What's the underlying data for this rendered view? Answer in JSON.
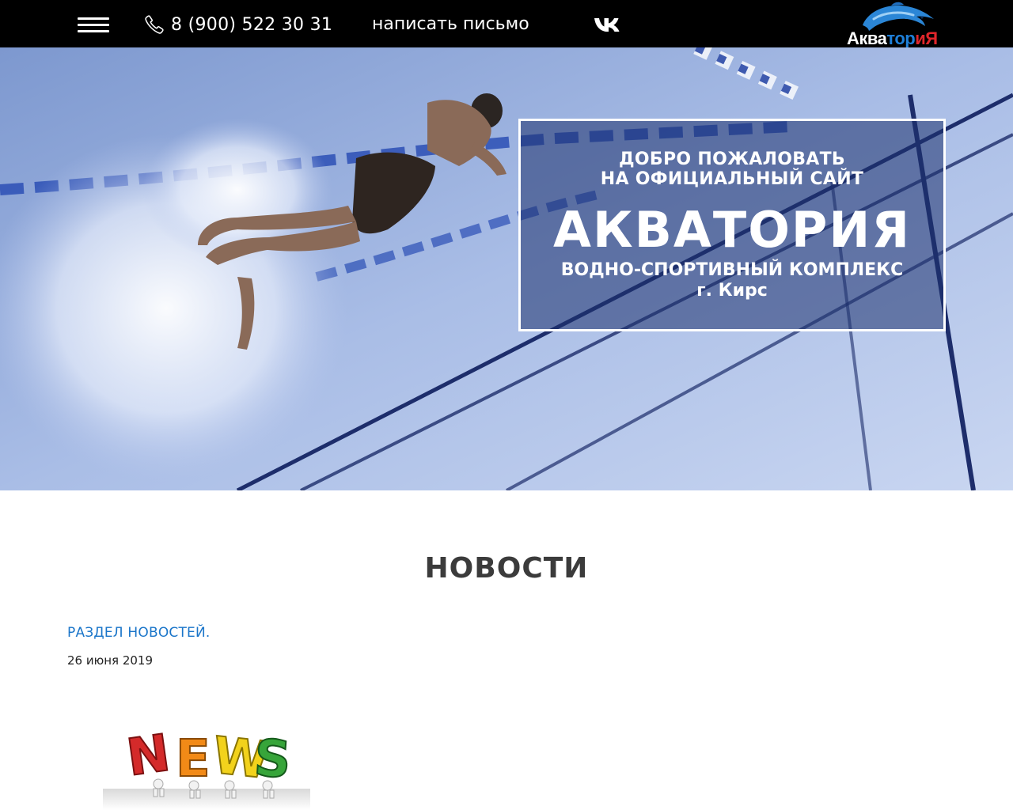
{
  "header": {
    "phone": "8 (900) 522 30 31",
    "mail_link": "написать письмо",
    "vk_icon": "vk-icon",
    "menu_icon": "hamburger-icon",
    "logo": {
      "part1": "Аква",
      "part2": "тор",
      "part3": "иЯ"
    }
  },
  "hero": {
    "welcome_line1": "ДОБРО ПОЖАЛОВАТЬ",
    "welcome_line2": "НА ОФИЦИАЛЬНЫЙ САЙТ",
    "brand": "АКВАТОРИЯ",
    "subtitle": "ВОДНО-СПОРТИВНЫЙ КОМПЛЕКС",
    "city": "г. Кирс"
  },
  "news": {
    "section_title": "НОВОСТИ",
    "items": [
      {
        "title": "РАЗДЕЛ НОВОСТЕЙ.",
        "date": "26 июня 2019",
        "image_letters": [
          "N",
          "E",
          "W",
          "S"
        ]
      }
    ]
  },
  "colors": {
    "topbar": "#000000",
    "link": "#1a75c9",
    "pool": "#7f9ed6",
    "logo_blue": "#1e7fd8",
    "logo_red": "#e0262b"
  }
}
